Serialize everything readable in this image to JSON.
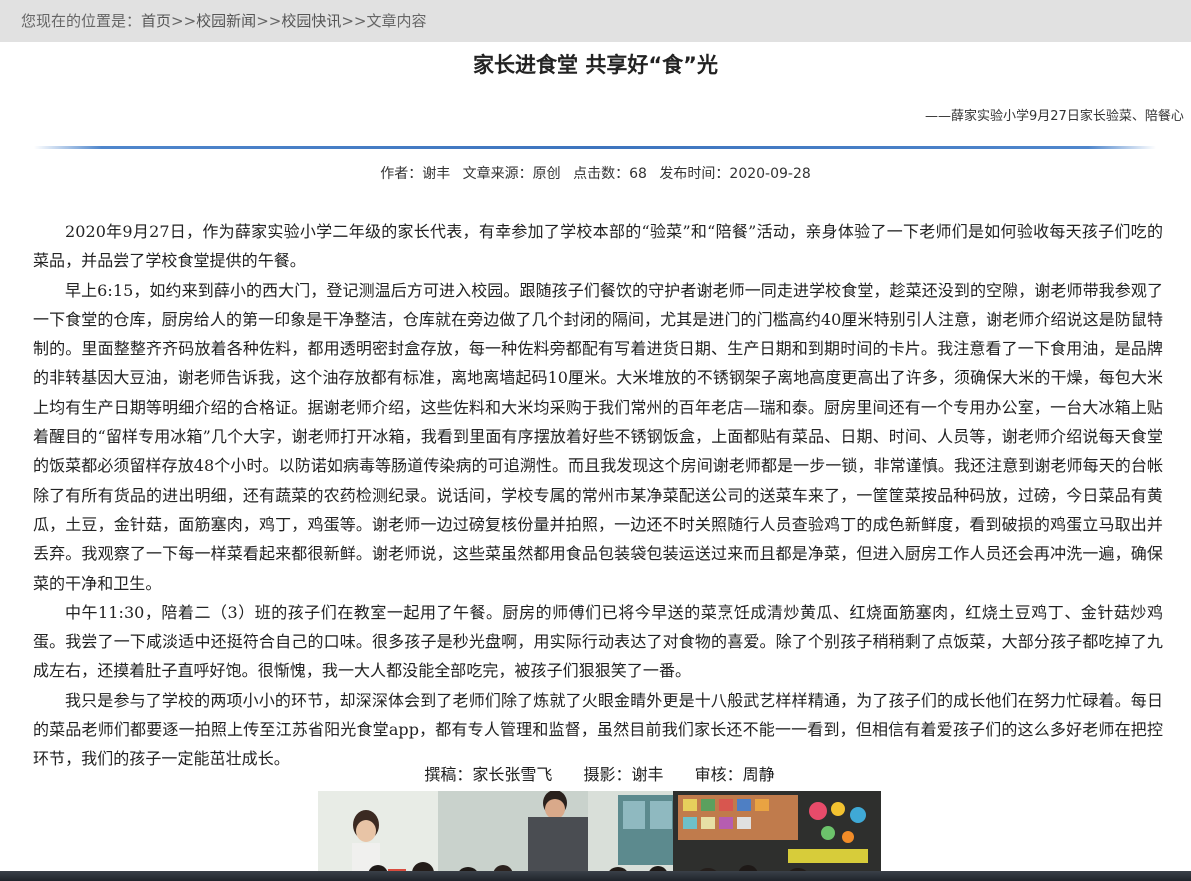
{
  "breadcrumb": {
    "prefix": "您现在的位置是：",
    "items": [
      "首页",
      "校园新闻",
      "校园快讯",
      "文章内容"
    ],
    "separator": ">>"
  },
  "article": {
    "title": "家长进食堂 共享好“食”光",
    "subtitle": "——薛家实验小学9月27日家长验菜、陪餐心",
    "meta": {
      "author": "作者：谢丰",
      "source": "文章来源：原创",
      "clicks": "点击数：68",
      "date": "发布时间：2020-09-28"
    },
    "paragraphs": [
      "2020年9月27日，作为薛家实验小学二年级的家长代表，有幸参加了学校本部的“验菜”和“陪餐”活动，亲身体验了一下老师们是如何验收每天孩子们吃的菜品，并品尝了学校食堂提供的午餐。",
      "早上6:15，如约来到薛小的西大门，登记测温后方可进入校园。跟随孩子们餐饮的守护者谢老师一同走进学校食堂，趁菜还没到的空隙，谢老师带我参观了一下食堂的仓库，厨房给人的第一印象是干净整洁，仓库就在旁边做了几个封闭的隔间，尤其是进门的门槛高约40厘米特别引人注意，谢老师介绍说这是防鼠特制的。里面整整齐齐码放着各种佐料，都用透明密封盒存放，每一种佐料旁都配有写着进货日期、生产日期和到期时间的卡片。我注意看了一下食用油，是品牌的非转基因大豆油，谢老师告诉我，这个油存放都有标准，离地离墙起码10厘米。大米堆放的不锈钢架子离地高度更高出了许多，须确保大米的干燥，每包大米上均有生产日期等明细介绍的合格证。据谢老师介绍，这些佐料和大米均采购于我们常州的百年老店—瑞和泰。厨房里间还有一个专用办公室，一台大冰箱上贴着醒目的“留样专用冰箱”几个大字，谢老师打开冰箱，我看到里面有序摆放着好些不锈钢饭盒，上面都贴有菜品、日期、时间、人员等，谢老师介绍说每天食堂的饭菜都必须留样存放48个小时。以防诺如病毒等肠道传染病的可追溯性。而且我发现这个房间谢老师都是一步一锁，非常谨慎。我还注意到谢老师每天的台帐除了有所有货品的进出明细，还有蔬菜的农药检测纪录。说话间，学校专属的常州市某净菜配送公司的送菜车来了，一筐筐菜按品种码放，过磅，今日菜品有黄瓜，土豆，金针菇，面筋塞肉，鸡丁，鸡蛋等。谢老师一边过磅复核份量并拍照，一边还不时关照随行人员查验鸡丁的成色新鲜度，看到破损的鸡蛋立马取出并丢弃。我观察了一下每一样菜看起来都很新鲜。谢老师说，这些菜虽然都用食品包装袋包装运送过来而且都是净菜，但进入厨房工作人员还会再冲洗一遍，确保菜的干净和卫生。",
      "中午11:30，陪着二（3）班的孩子们在教室一起用了午餐。厨房的师傅们已将今早送的菜烹饪成清炒黄瓜、红烧面筋塞肉，红烧土豆鸡丁、金针菇炒鸡蛋。我尝了一下咸淡适中还挺符合自己的口味。很多孩子是秒光盘啊，用实际行动表达了对食物的喜爱。除了个别孩子稍稍剩了点饭菜，大部分孩子都吃掉了九成左右，还摸着肚子直呼好饱。很惭愧，我一大人都没能全部吃完，被孩子们狠狠笑了一番。",
      "我只是参与了学校的两项小小的环节，却深深体会到了老师们除了炼就了火眼金睛外更是十八般武艺样样精通，为了孩子们的成长他们在努力忙碌着。每日的菜品老师们都要逐一拍照上传至江苏省阳光食堂app，都有专人管理和监督，虽然目前我们家长还不能一一看到，但相信有着爱孩子们的这么多好老师在把控环节，我们的孩子一定能茁壮成长。"
    ],
    "credits": {
      "writer": "撰稿：家长张雪飞",
      "photo": "摄影：谢丰",
      "review": "审核：周静"
    }
  },
  "colors": {
    "breadcrumb_bg": "#e1e1e1",
    "divider": "#3d74be",
    "text": "#222222"
  }
}
